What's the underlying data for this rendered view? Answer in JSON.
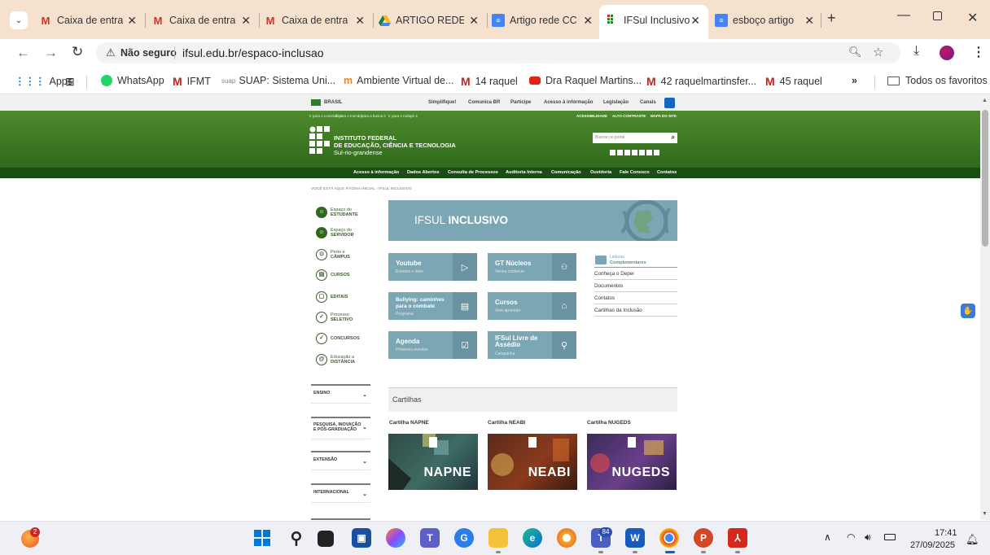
{
  "browser": {
    "tabs": [
      {
        "label": "Caixa de entra",
        "icon": "gmail-icon"
      },
      {
        "label": "Caixa de entra",
        "icon": "gmail-icon"
      },
      {
        "label": "Caixa de entra",
        "icon": "gmail-icon"
      },
      {
        "label": "ARTIGO REDE",
        "icon": "drive-icon"
      },
      {
        "label": "Artigo rede CC",
        "icon": "docs-icon"
      },
      {
        "label": "IFSul Inclusivo",
        "icon": "ifsul-icon",
        "active": true
      },
      {
        "label": "esboço artigo",
        "icon": "docs-icon"
      }
    ],
    "security": "Não seguro",
    "url": "ifsul.edu.br/espaco-inclusao",
    "bookmarks": [
      {
        "label": "Apps"
      },
      {
        "label": "WhatsApp"
      },
      {
        "label": "IFMT"
      },
      {
        "label": "SUAP: Sistema Uni...",
        "prefix": "suap"
      },
      {
        "label": "Ambiente Virtual de..."
      },
      {
        "label": "14 raquel"
      },
      {
        "label": "Dra Raquel Martins..."
      },
      {
        "label": "42 raquelmartinsfer..."
      },
      {
        "label": "45 raquel"
      }
    ],
    "bookmarks_more": "»",
    "all_bookmarks": "Todos os favoritos"
  },
  "site": {
    "gov": {
      "brasil": "BRASIL",
      "links": [
        "Simplifique!",
        "Comunica BR",
        "Participe",
        "Acesso à informação",
        "Legislação",
        "Canais"
      ]
    },
    "skip": [
      "Ir para o conteúdo 1",
      "Ir para o menu 2",
      "Ir para a busca 3",
      "Ir para o rodapé 4"
    ],
    "acc": [
      "ACESSIBILIDADE",
      "ALTO CONTRASTE",
      "MAPA DO SITE"
    ],
    "inst": {
      "line1": "INSTITUTO FEDERAL",
      "line2": "DE EDUCAÇÃO, CIÊNCIA E TECNOLOGIA",
      "line3": "Sul-rio-grandense"
    },
    "search_placeholder": "Buscar no portal",
    "nav": [
      "Acesso à informação",
      "Dados Abertos",
      "Consulta de Processos",
      "Auditoria Interna",
      "Comunicação",
      "Ouvidoria",
      "Fale Conosco",
      "Contatos"
    ],
    "breadcrumb": "VOCÊ ESTÁ AQUI: PÁGINA INICIAL › IFSUL INCLUSIVO",
    "sidebar": [
      {
        "l1": "Espaço do",
        "l2": "ESTUDANTE"
      },
      {
        "l1": "Espaço do",
        "l2": "SERVIDOR"
      },
      {
        "l1": "Perto e",
        "l2": "CÂMPUS"
      },
      {
        "l1": "",
        "l2": "CURSOS"
      },
      {
        "l1": "",
        "l2": "EDITAIS"
      },
      {
        "l1": "Processo",
        "l2": "SELETIVO"
      },
      {
        "l1": "",
        "l2": "CONCURSOS"
      },
      {
        "l1": "Educação a",
        "l2": "DISTÂNCIA"
      }
    ],
    "dropdowns": [
      "ENSINO",
      "PESQUISA, INOVAÇÃO E PÓS-GRADUAÇÃO",
      "EXTENSÃO",
      "INTERNACIONAL"
    ],
    "banner": {
      "part1": "IFSUL ",
      "part2": "INCLUSIVO"
    },
    "tiles": [
      {
        "title": "Youtube",
        "sub": "Eventos e lives"
      },
      {
        "title": "GT Núcleos",
        "sub": "Venha conhecer"
      },
      {
        "title": "Bullying: caminhes para o combate",
        "sub": "Programa"
      },
      {
        "title": "Cursos",
        "sub": "Vem aprender"
      },
      {
        "title": "Agenda",
        "sub": "Próximos eventos"
      },
      {
        "title": "IFSul Livre de Assédio",
        "sub": "Campanha"
      }
    ],
    "links_head": {
      "l1": "Leituras",
      "l2": "Complementares"
    },
    "links": [
      "Conheça o Depei",
      "Documentos",
      "Contatos",
      "Cartilhas da Inclusão"
    ],
    "cartilhas_title": "Cartilhas",
    "cards": [
      {
        "caption": "Cartilha NAPNE",
        "word": "NAPNE"
      },
      {
        "caption": "Cartilha NEABI",
        "word": "NEABI"
      },
      {
        "caption": "Cartilha NUGEDS",
        "word": "NUGEDS"
      }
    ]
  },
  "taskbar": {
    "badge_left": "2",
    "teams_badge": "84",
    "time": "17:41",
    "date": "27/09/2025"
  }
}
